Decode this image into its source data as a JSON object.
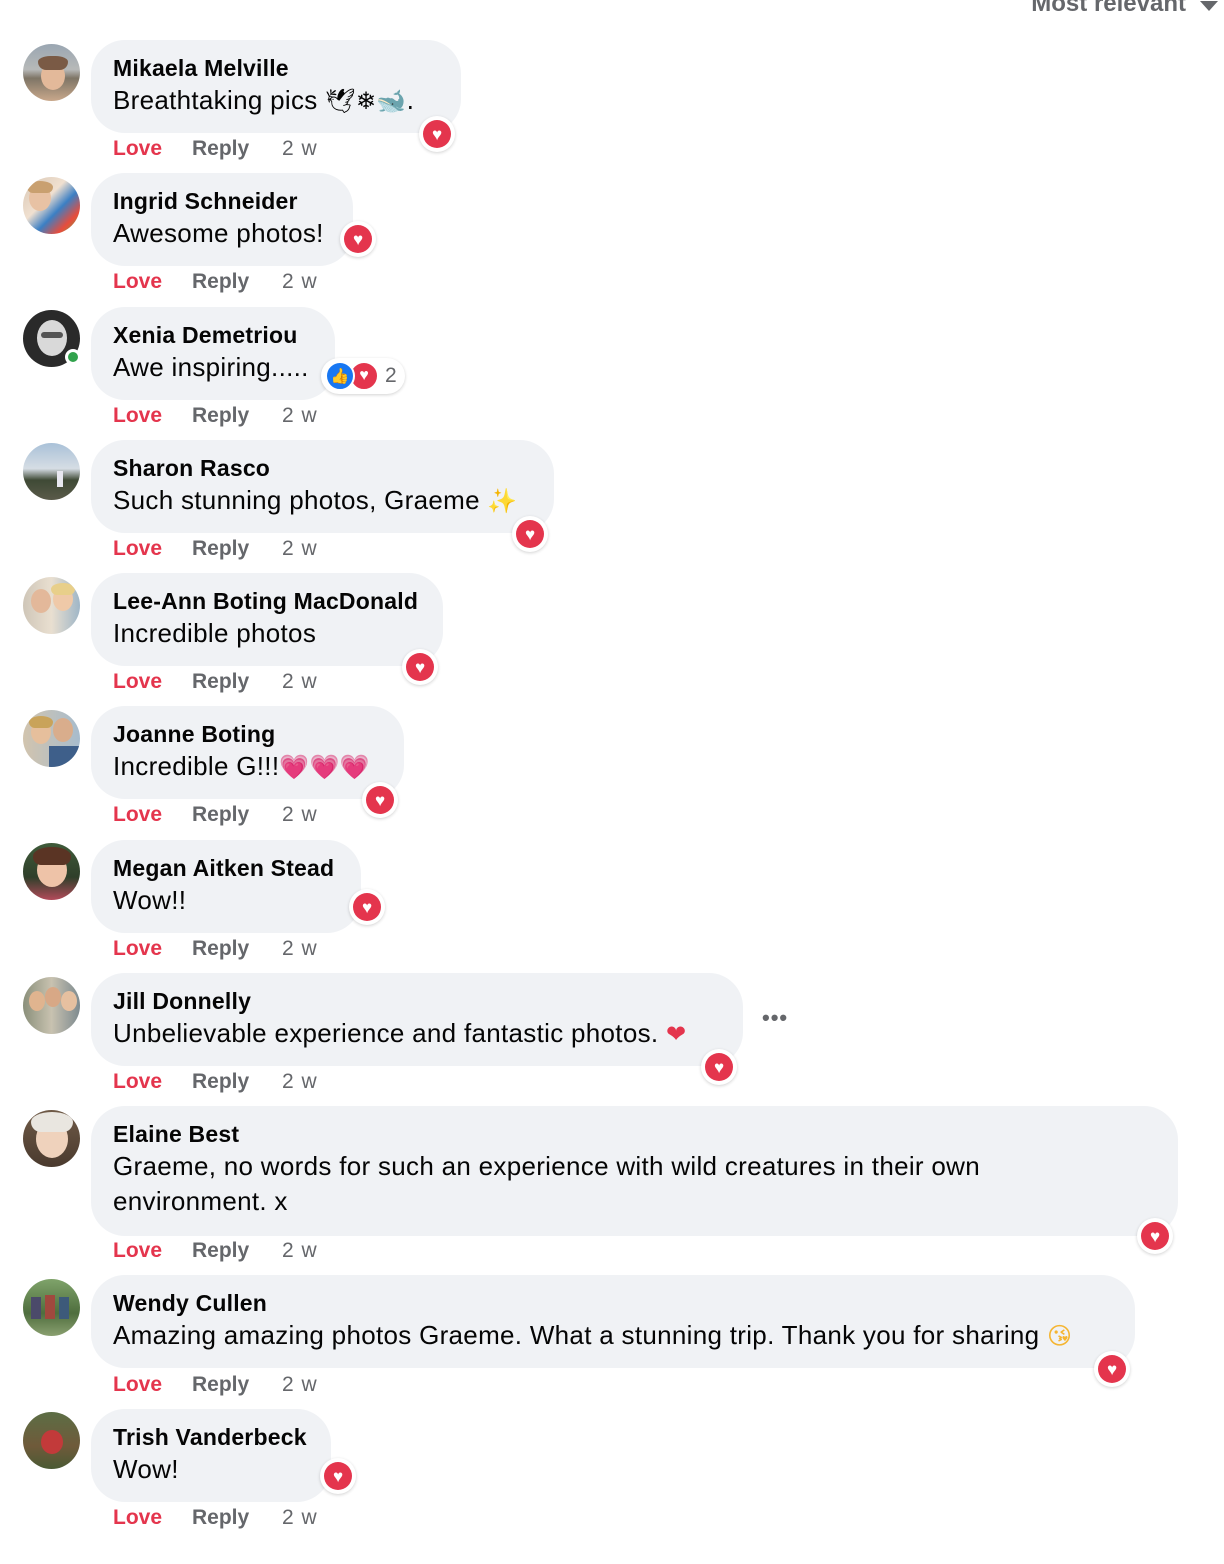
{
  "sort": {
    "label": "Most relevant"
  },
  "actions": {
    "love": "Love",
    "reply": "Reply"
  },
  "comments": [
    {
      "name": "Mikaela Melville",
      "text": "Breathtaking pics",
      "emoji": "🕊❄🐋.",
      "time": "2 w",
      "reaction": "love"
    },
    {
      "name": "Ingrid Schneider",
      "text": "Awesome photos!",
      "time": "2 w",
      "reaction": "love"
    },
    {
      "name": "Xenia Demetriou",
      "text": "Awe inspiring.....",
      "time": "2 w",
      "reaction": "like+love",
      "reaction_count": "2",
      "online": true
    },
    {
      "name": "Sharon Rasco",
      "text": "Such stunning photos, Graeme",
      "emoji": "✨",
      "time": "2 w",
      "reaction": "love"
    },
    {
      "name": "Lee-Ann Boting MacDonald",
      "text": "Incredible photos",
      "time": "2 w",
      "reaction": "love"
    },
    {
      "name": "Joanne Boting",
      "text": "Incredible G!!!",
      "emoji": "💗💗💗",
      "time": "2 w",
      "reaction": "love"
    },
    {
      "name": "Megan Aitken Stead",
      "text": "Wow!!",
      "time": "2 w",
      "reaction": "love"
    },
    {
      "name": "Jill Donnelly",
      "text": "Unbelievable experience and fantastic photos.",
      "emoji": "❤",
      "time": "2 w",
      "reaction": "love"
    },
    {
      "name": "Elaine Best",
      "text": "Graeme, no words for such an experience with wild creatures in their own environment. x",
      "time": "2 w",
      "reaction": "love"
    },
    {
      "name": "Wendy Cullen",
      "text": "Amazing amazing photos Graeme. What a stunning trip. Thank you for sharing",
      "emoji": "😘",
      "time": "2 w",
      "reaction": "love"
    },
    {
      "name": "Trish Vanderbeck",
      "text": "Wow!",
      "time": "2 w",
      "reaction": "love"
    }
  ],
  "colors": {
    "love_red": "#e4354d",
    "bubble_bg": "#f0f2f5",
    "meta_gray": "#65676b",
    "like_blue": "#1877f2",
    "online_green": "#31a24c"
  },
  "icons": {
    "heart": "heart-icon",
    "like": "thumbs-up-icon",
    "more": "more-options-icon",
    "sort": "chevron-down-icon"
  }
}
